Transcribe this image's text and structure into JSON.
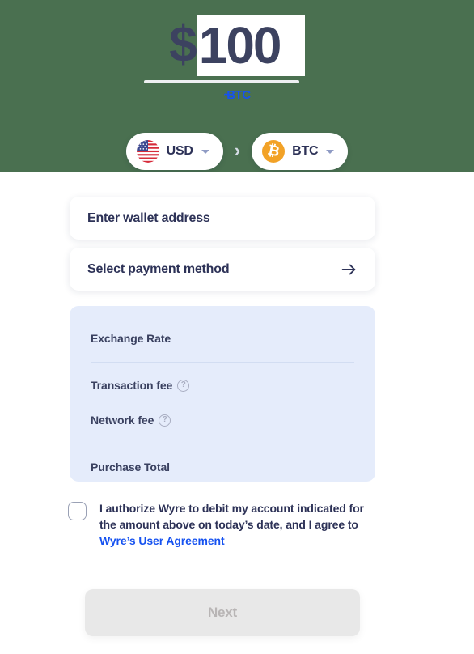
{
  "header": {
    "currency_symbol": "$",
    "amount_value": "100",
    "estimate_amount": "~",
    "estimate_currency": "BTC",
    "estimate_color": "#1652f0",
    "background_color": "#4a7050"
  },
  "currency_selector": {
    "from": {
      "code": "USD",
      "icon": "us-flag-icon"
    },
    "separator": "›",
    "to": {
      "code": "BTC",
      "icon": "bitcoin-icon",
      "icon_color": "#f2a227",
      "icon_glyph": "₿"
    }
  },
  "form": {
    "wallet_label": "Enter wallet address",
    "payment_label": "Select payment method",
    "payment_arrow_icon": "arrow-right-icon"
  },
  "summary": {
    "background_color": "#e5ecfb",
    "rows": [
      {
        "label": "Exchange Rate",
        "value": "",
        "help": false
      },
      {
        "label": "Transaction fee",
        "value": "",
        "help": true
      },
      {
        "label": "Network fee",
        "value": "",
        "help": true
      },
      {
        "label": "Purchase Total",
        "value": "",
        "help": false
      }
    ],
    "help_glyph": "?"
  },
  "authorization": {
    "checked": false,
    "text_part_1": "I authorize Wyre to debit my account indicated for the amount above on today’s date, and I agree to ",
    "link_text": "Wyre’s User Agreement",
    "link_color": "#1652f0"
  },
  "footer": {
    "next_label": "Next",
    "next_disabled": true
  }
}
